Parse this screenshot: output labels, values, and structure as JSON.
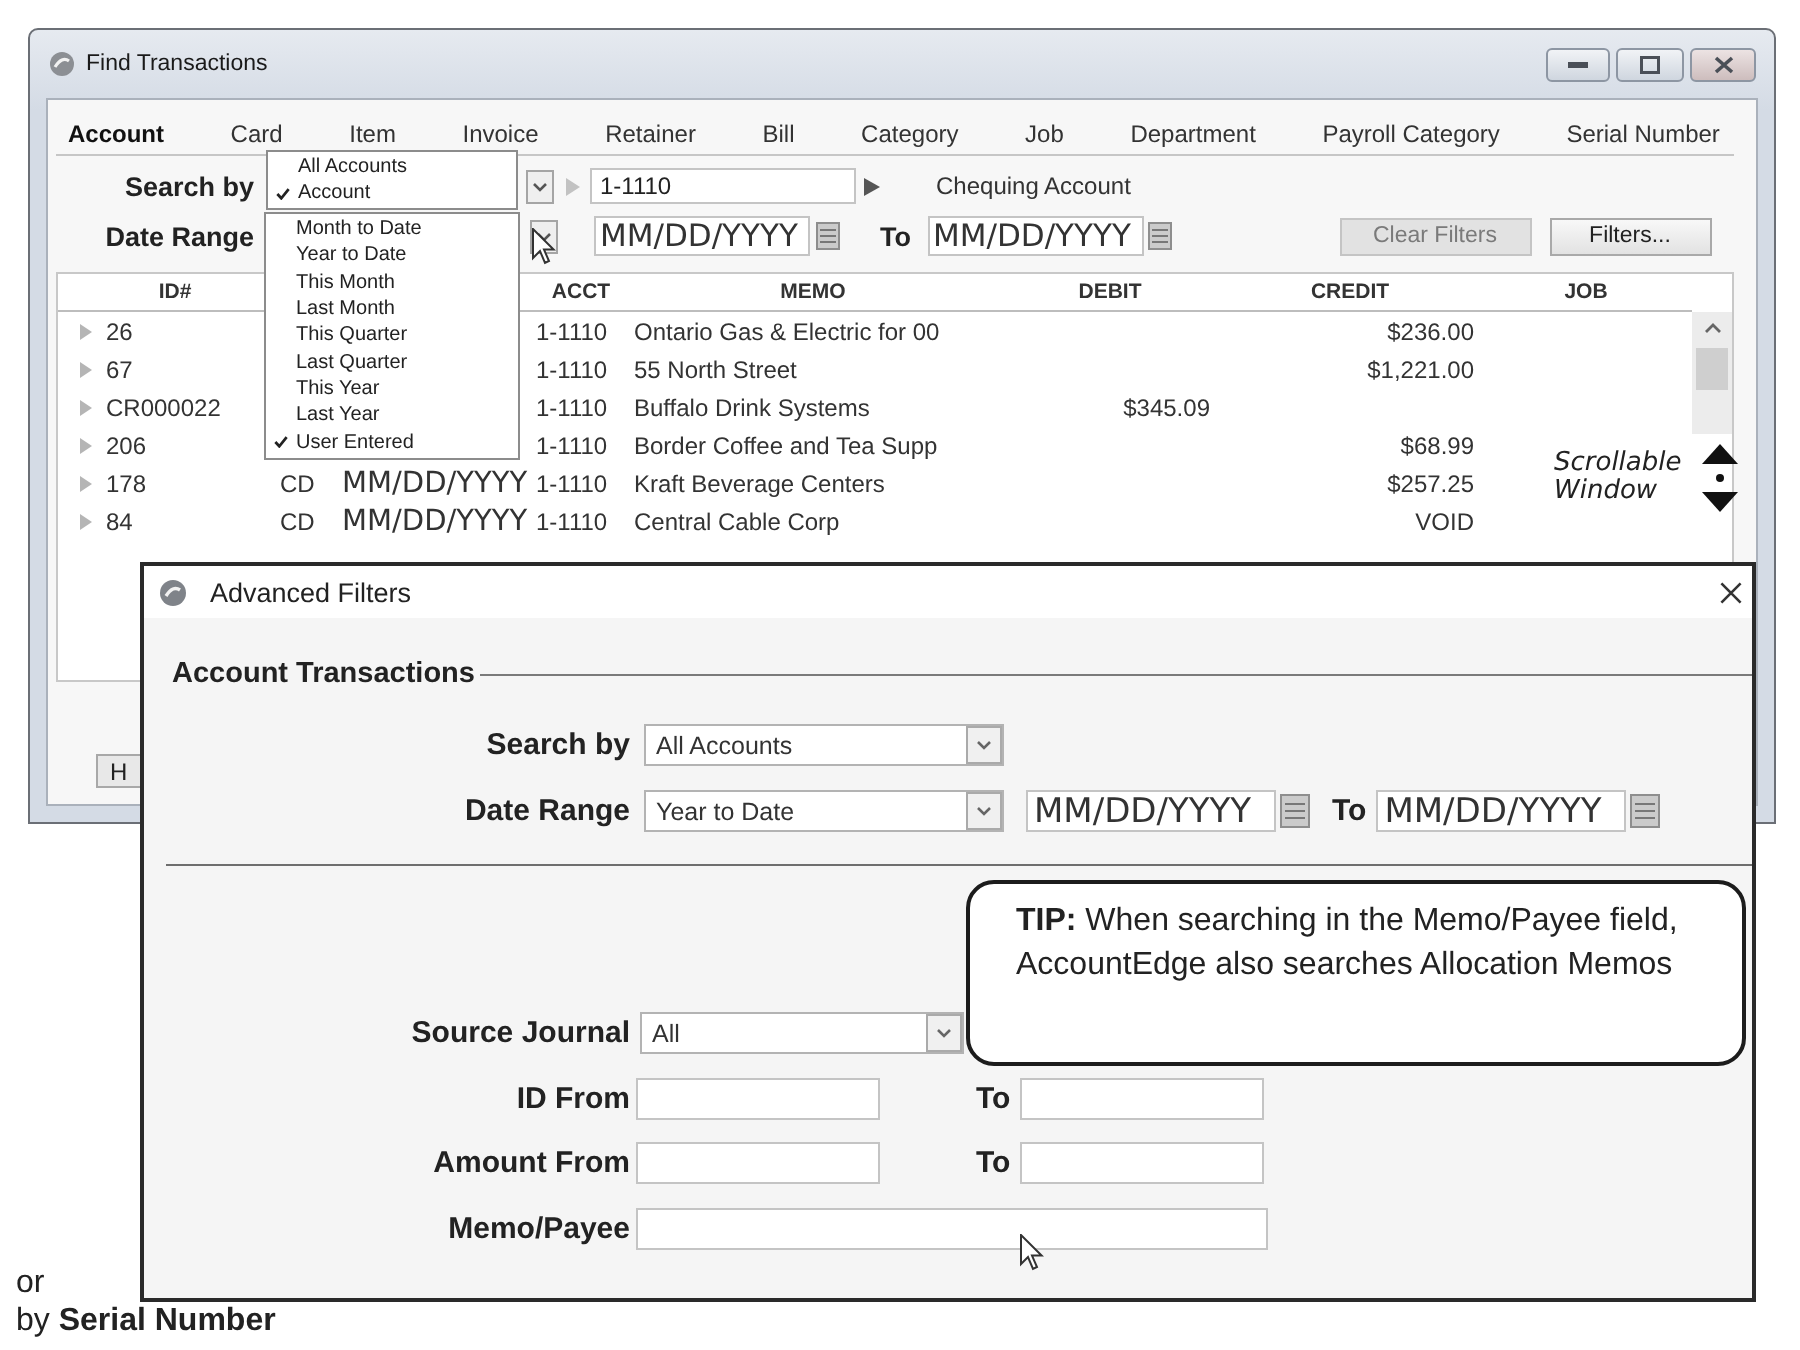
{
  "find_window": {
    "title": "Find Transactions",
    "tabs": [
      {
        "label": "Account",
        "selected": true
      },
      {
        "label": "Card",
        "selected": false
      },
      {
        "label": "Item",
        "selected": false
      },
      {
        "label": "Invoice",
        "selected": false
      },
      {
        "label": "Retainer",
        "selected": false
      },
      {
        "label": "Bill",
        "selected": false
      },
      {
        "label": "Category",
        "selected": false
      },
      {
        "label": "Job",
        "selected": false
      },
      {
        "label": "Department",
        "selected": false
      },
      {
        "label": "Payroll Category",
        "selected": false
      },
      {
        "label": "Serial Number",
        "selected": false
      }
    ],
    "search_by": {
      "label": "Search by",
      "value": "1-1110",
      "account_name": "Chequing Account"
    },
    "date_range": {
      "label": "Date Range",
      "from": "MM/DD/YYYY",
      "to_label": "To",
      "to": "MM/DD/YYYY"
    },
    "buttons": [
      {
        "label": "Clear Filters",
        "disabled": true
      },
      {
        "label": "Filters...",
        "disabled": false
      }
    ],
    "table": {
      "columns": [
        "ID#",
        "ACCT",
        "MEMO",
        "DEBIT",
        "CREDIT",
        "JOB"
      ],
      "rows": [
        {
          "id": "26",
          "acct": "1-1110",
          "memo": "Ontario Gas & Electric for 00",
          "credit": "$236.00"
        },
        {
          "id": "67",
          "acct": "1-1110",
          "memo": "55 North Street",
          "credit": "$1,221.00"
        },
        {
          "id": "CR000022",
          "acct": "1-1110",
          "memo": "Buffalo Drink Systems",
          "debit": "$345.09"
        },
        {
          "id": "206",
          "acct": "1-1110",
          "memo": "Border Coffee and Tea Supp",
          "credit": "$68.99"
        },
        {
          "id": "178",
          "src": "CD",
          "date": "MM/DD/YYYY",
          "acct": "1-1110",
          "memo": "Kraft Beverage Centers",
          "credit": "$257.25"
        },
        {
          "id": "84",
          "src": "CD",
          "date": "MM/DD/YYYY",
          "acct": "1-1110",
          "memo": "Central Cable Corp",
          "credit": "VOID"
        }
      ]
    },
    "scroll_note": "Scrollable Window",
    "help_button": {
      "label": "H"
    }
  },
  "search_menu": {
    "items": [
      {
        "label": "All Accounts",
        "checked": false
      },
      {
        "label": "Account",
        "checked": true
      }
    ]
  },
  "date_menu": {
    "items": [
      {
        "label": "Month to Date",
        "checked": false
      },
      {
        "label": "Year to Date",
        "checked": false
      },
      {
        "label": "This Month",
        "checked": false
      },
      {
        "label": "Last Month",
        "checked": false
      },
      {
        "label": "This Quarter",
        "checked": false
      },
      {
        "label": "Last Quarter",
        "checked": false
      },
      {
        "label": "This Year",
        "checked": false
      },
      {
        "label": "Last Year",
        "checked": false
      },
      {
        "label": "User Entered",
        "checked": true
      }
    ]
  },
  "advanced_filters": {
    "title": "Advanced Filters",
    "group_label": "Account Transactions",
    "search_by": {
      "label": "Search by",
      "value": "All Accounts"
    },
    "date_range": {
      "label": "Date Range",
      "value": "Year to Date",
      "from": "MM/DD/YYYY",
      "to_label": "To",
      "to": "MM/DD/YYYY"
    },
    "tip": "**TIP:** When searching in the Memo/Payee field, AccountEdge also searches Allocation Memos",
    "source_journal": {
      "label": "Source Journal",
      "value": "All"
    },
    "id_range": {
      "label": "ID From",
      "to_label": "To"
    },
    "amount_range": {
      "label": "Amount From",
      "to_label": "To"
    },
    "memo_payee": {
      "label": "Memo/Payee"
    }
  },
  "caption": {
    "line_1": "or",
    "line_2": "by **Serial Number**"
  }
}
